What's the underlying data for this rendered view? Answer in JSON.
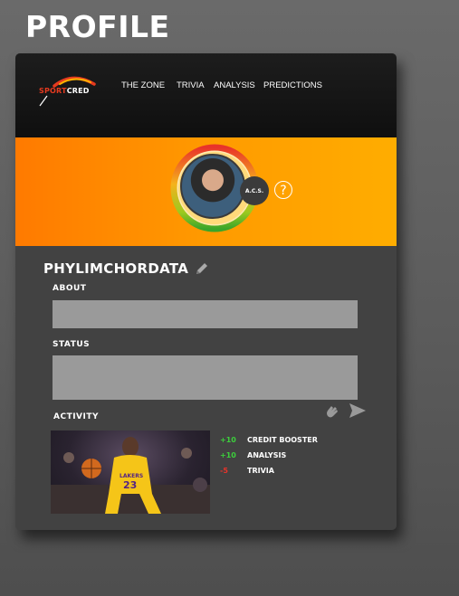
{
  "page_title": "PROFILE",
  "navbar": {
    "logo_text_a": "SPORT",
    "logo_text_b": "CRED",
    "links": [
      "THE ZONE",
      "TRIVIA",
      "ANALYSIS",
      "PREDICTIONS"
    ]
  },
  "profile": {
    "acs_label": "A.C.S.",
    "help_symbol": "?",
    "username": "PHYLIMCHORDATA"
  },
  "sections": {
    "about_label": "ABOUT",
    "about_value": "",
    "status_label": "STATUS",
    "status_value": "",
    "activity_label": "ACTIVITY"
  },
  "activity": [
    {
      "points": "+10",
      "label": "CREDIT BOOSTER",
      "type": "positive"
    },
    {
      "points": "+10",
      "label": "ANALYSIS",
      "type": "positive"
    },
    {
      "points": "-5",
      "label": "TRIVIA",
      "type": "negative"
    }
  ],
  "icons": {
    "edit": "pencil-icon",
    "clap": "clap-icon",
    "send": "send-icon",
    "help": "help-icon"
  },
  "colors": {
    "banner_start": "#ff7a00",
    "banner_end": "#ffad00",
    "card_bg": "#424242",
    "positive": "#3ccf3c",
    "negative": "#e8332a"
  }
}
